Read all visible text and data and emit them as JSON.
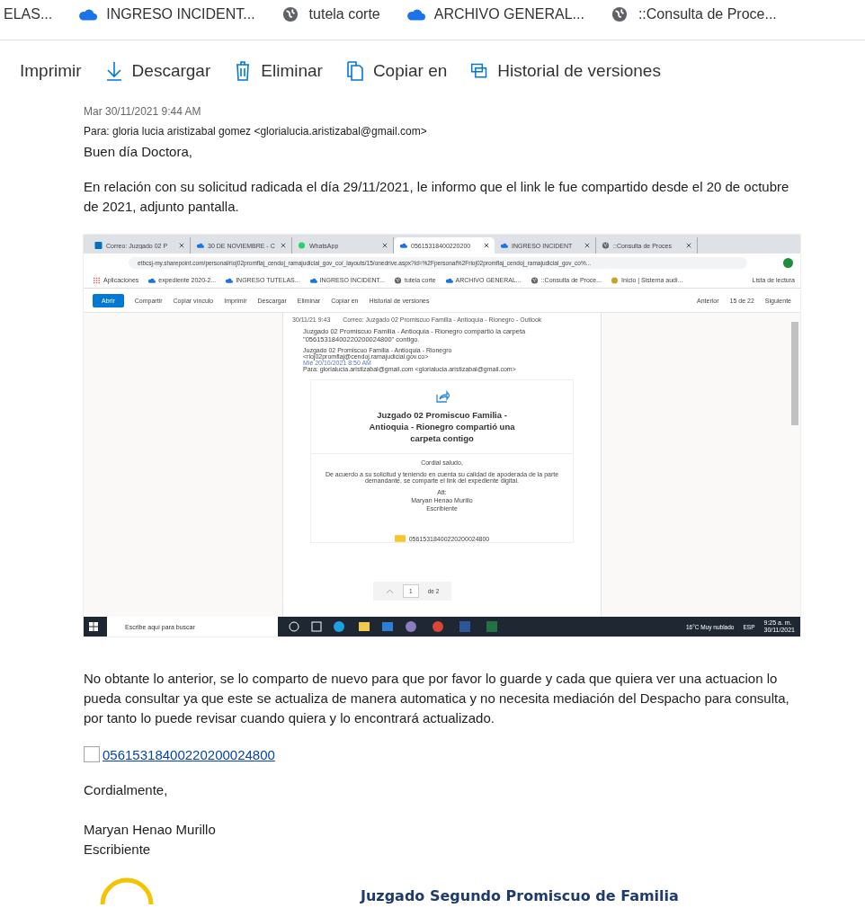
{
  "bookmarks_bar": {
    "items": [
      {
        "label": "ELAS..."
      },
      {
        "label": "INGRESO INCIDENT..."
      },
      {
        "label": "tutela corte"
      },
      {
        "label": "ARCHIVO GENERAL..."
      },
      {
        "label": "::Consulta de Proce..."
      }
    ]
  },
  "toolbar": {
    "items": [
      {
        "label": "Imprimir"
      },
      {
        "label": "Descargar"
      },
      {
        "label": "Eliminar"
      },
      {
        "label": "Copiar en"
      },
      {
        "label": "Historial de versiones"
      }
    ]
  },
  "email": {
    "date": "Mar 30/11/2021 9:44 AM",
    "to_label": "Para:",
    "to": "gloria lucia aristizabal gomez <glorialucia.aristizabal@gmail.com>",
    "greeting": "Buen día Doctora,",
    "paragraph_1": "En relación con su solicitud radicada el día 29/11/2021, le informo que el link le fue compartido desde el 20 de octubre de 2021, adjunto pantalla.",
    "paragraph_2": "No obtante lo anterior, se lo comparto de nuevo para que por favor lo guarde y cada que quiera ver una actuacion lo pueda consultar ya que este se actualiza de manera automatica y no necesita mediación del Despacho para consulta, por tanto lo puede revisar cuando quiera y lo encontrará actualizado.",
    "link": "05615318400220200024800",
    "closing": "Cordialmente,",
    "signer_name": "Maryan Henao Murillo",
    "signer_role": "Escribiente",
    "signature_org": "Juzgado Segundo Promiscuo de Familia"
  },
  "attached_screenshot": {
    "tabs": [
      {
        "label": "Correo: Juzgado 02 P",
        "selected": false
      },
      {
        "label": "30 DE NOVIEMBRE - C",
        "selected": false
      },
      {
        "label": "WhatsApp",
        "selected": false
      },
      {
        "label": "05615318400220200",
        "selected": true
      },
      {
        "label": "INGRESO INCIDENT",
        "selected": false
      },
      {
        "label": "::Consulta de Proces",
        "selected": false
      }
    ],
    "address": "etbcsj-my.sharepoint.com/personal/rioj02promflaj_cendoj_ramajudicial_gov_co/_layouts/15/onedrive.aspx?id=%2Fpersonal%2Frioj02promflaj_cendoj_ramajudicial_gov_co%...",
    "bookmarks": [
      {
        "label": "Aplicaciones"
      },
      {
        "label": "expediente 2020-2..."
      },
      {
        "label": "INGRESO TUTELAS..."
      },
      {
        "label": "INGRESO INCIDENT..."
      },
      {
        "label": "tutela corte"
      },
      {
        "label": "ARCHIVO GENERAL..."
      },
      {
        "label": "::Consulta de Proce..."
      },
      {
        "label": "Inicio | Sistema audi..."
      }
    ],
    "reading_list": "Lista de lectura",
    "open_button": "Abrir",
    "commands": [
      "Compartir",
      "Copiar vínculo",
      "Imprimir",
      "Descargar",
      "Eliminar",
      "Copiar en",
      "Historial de versiones"
    ],
    "previous": "Anterior",
    "position": "15 de 22",
    "next": "Siguiente",
    "document": {
      "print_date": "30/11/21 9:43",
      "print_title": "Correo: Juzgado 02 Promiscuo Familia - Antioquia - Rionegro - Outlook",
      "subject": "Juzgado 02 Promiscuo Familia - Antioquia - Rionegro compartió la carpeta \"05615318400220200024800\" contigo.",
      "sender": "Juzgado 02 Promiscuo Familia - Antioquia - Rionegro",
      "sender_address": "<rioj02promflaj@cendoj.ramajudicial.gov.co>",
      "sent": "Mié 20/10/2021 8:50 AM",
      "recipient": "Para: glorialucia.aristizabal@gmail.com <glorialucia.aristizabal@gmail.com>",
      "card_heading": "Juzgado 02 Promiscuo Familia - Antioquia - Rionegro compartió una carpeta contigo",
      "card_greeting": "Cordial saludo,",
      "card_body": "De acuerdo a su solicitud y teniendo en cuenta su calidad de apoderada de la parte demandante, se comparte el link del expediente digital.",
      "card_att": "Att:",
      "card_name": "Maryan Henao Murillo",
      "card_role": "Escribiente",
      "page_number": "1",
      "page_total": "de 2",
      "folder": "05615318400220200024800"
    },
    "taskbar": {
      "search_placeholder": "Escribe aquí para buscar",
      "weather": "16°C  Muy nublado",
      "language": "ESP",
      "time": "9:25 a. m.",
      "date": "30/11/2021"
    }
  }
}
